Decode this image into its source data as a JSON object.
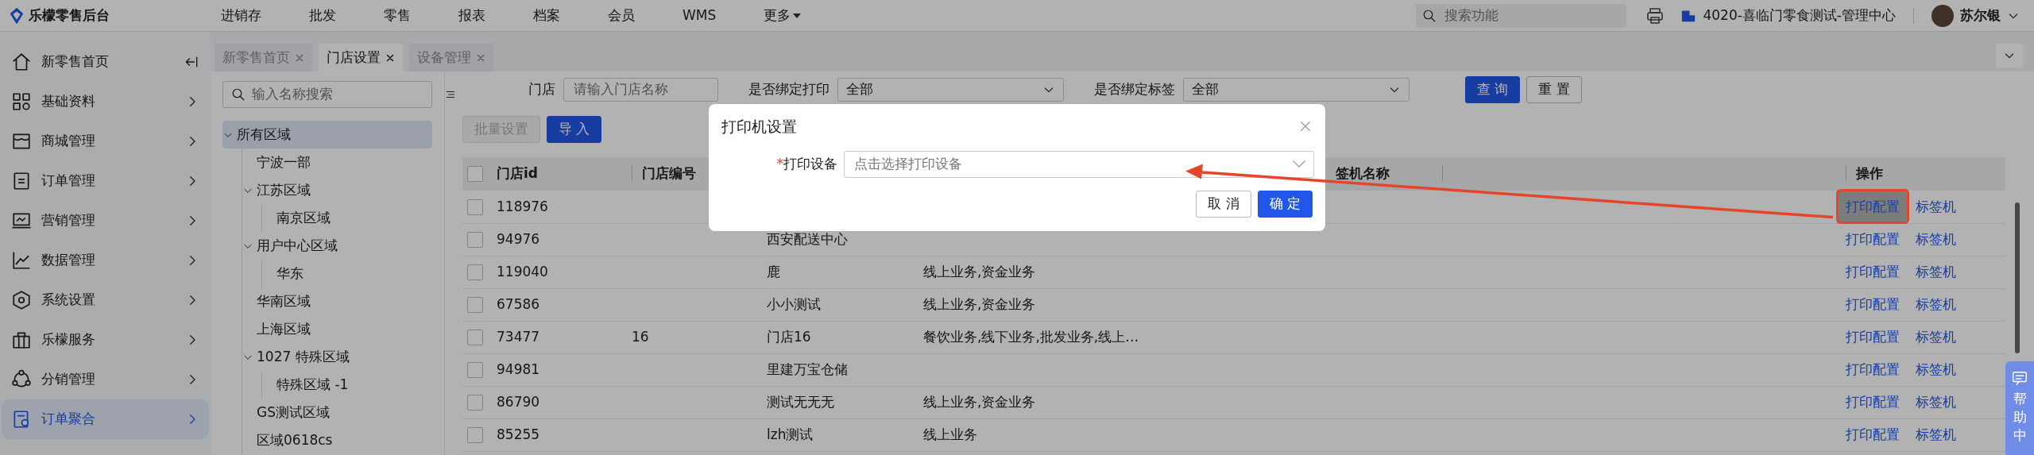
{
  "brand": {
    "name": "乐檬零售后台"
  },
  "top_nav": [
    {
      "label": "进销存",
      "kind": "link"
    },
    {
      "label": "批发",
      "kind": "link"
    },
    {
      "label": "零售",
      "kind": "link"
    },
    {
      "label": "报表",
      "kind": "link"
    },
    {
      "label": "档案",
      "kind": "link"
    },
    {
      "label": "会员",
      "kind": "link"
    },
    {
      "label": "WMS",
      "kind": "link"
    },
    {
      "label": "更多",
      "kind": "dropdown"
    }
  ],
  "search": {
    "placeholder": "搜索功能"
  },
  "organization": "4020-喜临门零食测试-管理中心",
  "user": {
    "name": "苏尔银"
  },
  "sidebar": {
    "items": [
      {
        "label": "新零售首页",
        "selected": false,
        "kind": "home"
      },
      {
        "label": "基础资料",
        "selected": false,
        "kind": "menu"
      },
      {
        "label": "商城管理",
        "selected": false,
        "kind": "menu"
      },
      {
        "label": "订单管理",
        "selected": false,
        "kind": "menu"
      },
      {
        "label": "营销管理",
        "selected": false,
        "kind": "menu"
      },
      {
        "label": "数据管理",
        "selected": false,
        "kind": "menu"
      },
      {
        "label": "系统设置",
        "selected": false,
        "kind": "menu"
      },
      {
        "label": "乐檬服务",
        "selected": false,
        "kind": "menu"
      },
      {
        "label": "分销管理",
        "selected": false,
        "kind": "menu"
      },
      {
        "label": "订单聚合",
        "selected": true,
        "kind": "menu"
      }
    ]
  },
  "tabs": [
    {
      "label": "新零售首页",
      "selected": false
    },
    {
      "label": "门店设置",
      "selected": true
    },
    {
      "label": "设备管理",
      "selected": false
    }
  ],
  "tree": {
    "placeholder": "输入名称搜索",
    "nodes": [
      {
        "label": "所有区域",
        "selected": true,
        "expanded": true,
        "children": [
          {
            "label": "宁波一部",
            "selected": false
          },
          {
            "label": "江苏区域",
            "selected": false,
            "expanded": true,
            "children": [
              {
                "label": "南京区域",
                "selected": false
              }
            ]
          },
          {
            "label": "用户中心区域",
            "selected": false,
            "expanded": true,
            "children": [
              {
                "label": "华东",
                "selected": false
              }
            ]
          },
          {
            "label": "华南区域",
            "selected": false
          },
          {
            "label": "上海区域",
            "selected": false
          },
          {
            "label": "1027 特殊区域",
            "selected": false,
            "expanded": true,
            "children": [
              {
                "label": "特殊区域 -1",
                "selected": false
              }
            ]
          },
          {
            "label": "GS测试区域",
            "selected": false
          },
          {
            "label": "区域0618cs",
            "selected": false
          }
        ]
      }
    ]
  },
  "filters": [
    {
      "label": "门店",
      "kind": "input",
      "placeholder": "请输入门店名称"
    },
    {
      "label": "是否绑定打印",
      "kind": "select",
      "value": "全部"
    },
    {
      "label": "是否绑定标签",
      "kind": "select",
      "value": "全部"
    }
  ],
  "filter_buttons": [
    {
      "label": "查 询",
      "kind": "primary"
    },
    {
      "label": "重 置",
      "kind": "secondary"
    }
  ],
  "actions": [
    {
      "label": "批量设置",
      "kind": "secondary",
      "disabled": true
    },
    {
      "label": "导 入",
      "kind": "primary",
      "disabled": false
    }
  ],
  "table": {
    "header_checked": false,
    "columns": [
      {
        "label": "门店id",
        "kind": "id"
      },
      {
        "label": "门店编号",
        "kind": "code"
      },
      {
        "label": "签机名称",
        "kind": "label_printer"
      },
      {
        "label": "操作",
        "kind": "actions"
      }
    ],
    "rows": [
      {
        "checked": false,
        "store_id": "118976",
        "annotated": true,
        "actions": [
          "打印配置",
          "标签机"
        ]
      },
      {
        "checked": false,
        "store_id": "94976",
        "name": "西安配送中心",
        "annotated": false,
        "actions": [
          "打印配置",
          "标签机"
        ]
      },
      {
        "checked": false,
        "store_id": "119040",
        "name": "鹿",
        "business": "线上业务,资金业务",
        "annotated": false,
        "actions": [
          "打印配置",
          "标签机"
        ]
      },
      {
        "checked": false,
        "store_id": "67586",
        "name": "小小测试",
        "business": "线上业务,资金业务",
        "annotated": false,
        "actions": [
          "打印配置",
          "标签机"
        ]
      },
      {
        "checked": false,
        "store_id": "73477",
        "store_code": "16",
        "name": "门店16",
        "business": "餐饮业务,线下业务,批发业务,线上…",
        "annotated": false,
        "actions": [
          "打印配置",
          "标签机"
        ]
      },
      {
        "checked": false,
        "store_id": "94981",
        "name": "里建万宝仓储",
        "annotated": false,
        "actions": [
          "打印配置",
          "标签机"
        ]
      },
      {
        "checked": false,
        "store_id": "86790",
        "name": "测试无无无",
        "business": "线上业务,资金业务",
        "annotated": false,
        "actions": [
          "打印配置",
          "标签机"
        ]
      },
      {
        "checked": false,
        "store_id": "85255",
        "name": "lzh测试",
        "business": "线上业务",
        "annotated": false,
        "actions": [
          "打印配置",
          "标签机"
        ]
      }
    ]
  },
  "dialog": {
    "title": "打印机设置",
    "fields": [
      {
        "label": "打印设备",
        "required_mark": "*",
        "placeholder": "点击选择打印设备"
      }
    ],
    "buttons": [
      {
        "label": "取 消",
        "kind": "secondary"
      },
      {
        "label": "确 定",
        "kind": "primary"
      }
    ]
  },
  "help": {
    "label": "帮助中"
  }
}
